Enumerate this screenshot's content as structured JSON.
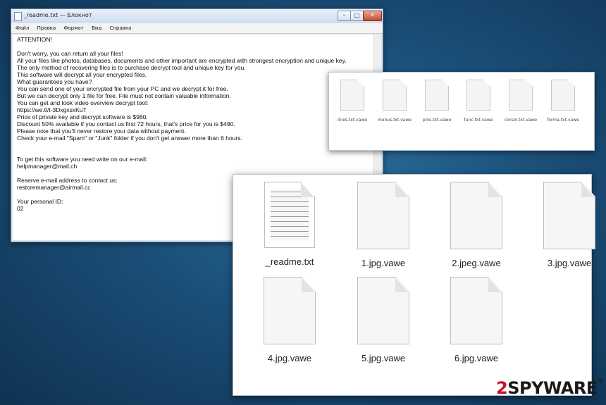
{
  "notepad": {
    "title": "_readme.txt — Блокнот",
    "menu": [
      "Файл",
      "Правка",
      "Формат",
      "Вид",
      "Справка"
    ],
    "lines": [
      "ATTENTION!",
      "",
      "Don't worry, you can return all your files!",
      "All your files like photos, databases, documents and other important are encrypted with strongest encryption and unique key.",
      "The only method of recovering files is to purchase decrypt tool and unique key for you.",
      "This software will decrypt all your encrypted files.",
      "What guarantees you have?",
      "You can send one of your encrypted file from your PC and we decrypt it for free.",
      "But we can decrypt only 1 file for free. File must not contain valuable information.",
      "You can get and look video overview decrypt tool:",
      "https://we.tl/t-3DxgxsxKuT",
      "Price of private key and decrypt software is $980.",
      "Discount 50% available if you contact us first 72 hours, that's price for you is $490.",
      "Please note that you'll never restore your data without payment.",
      "Check your e-mail \"Spam\" or \"Junk\" folder if you don't get answer more than 6 hours.",
      "",
      "",
      "To get this software you need write on our e-mail:",
      "helpmanager@mail.ch",
      "",
      "Reserve e-mail address to contact us:",
      "restoremanager@airmail.cc",
      "",
      "Your personal ID:",
      "02"
    ]
  },
  "small_files": [
    "lines.txt.vawe",
    "menus.txt.vawe",
    "pins.txt.vawe",
    "func.txt.vawe",
    "conan.txt.vawe",
    "forma.txt.vawe"
  ],
  "big_files": [
    "_readme.txt",
    "1.jpg.vawe",
    "2.jpeg.vawe",
    "3.jpg.vawe",
    "4.jpg.vawe",
    "5.jpg.vawe",
    "6.jpg.vawe"
  ],
  "brand": {
    "prefix": "2",
    "name": "SPYWAR",
    "suffix": "E"
  },
  "colors": {
    "brand_red": "#c8102e",
    "desktop_blue": "#1b4f78"
  }
}
